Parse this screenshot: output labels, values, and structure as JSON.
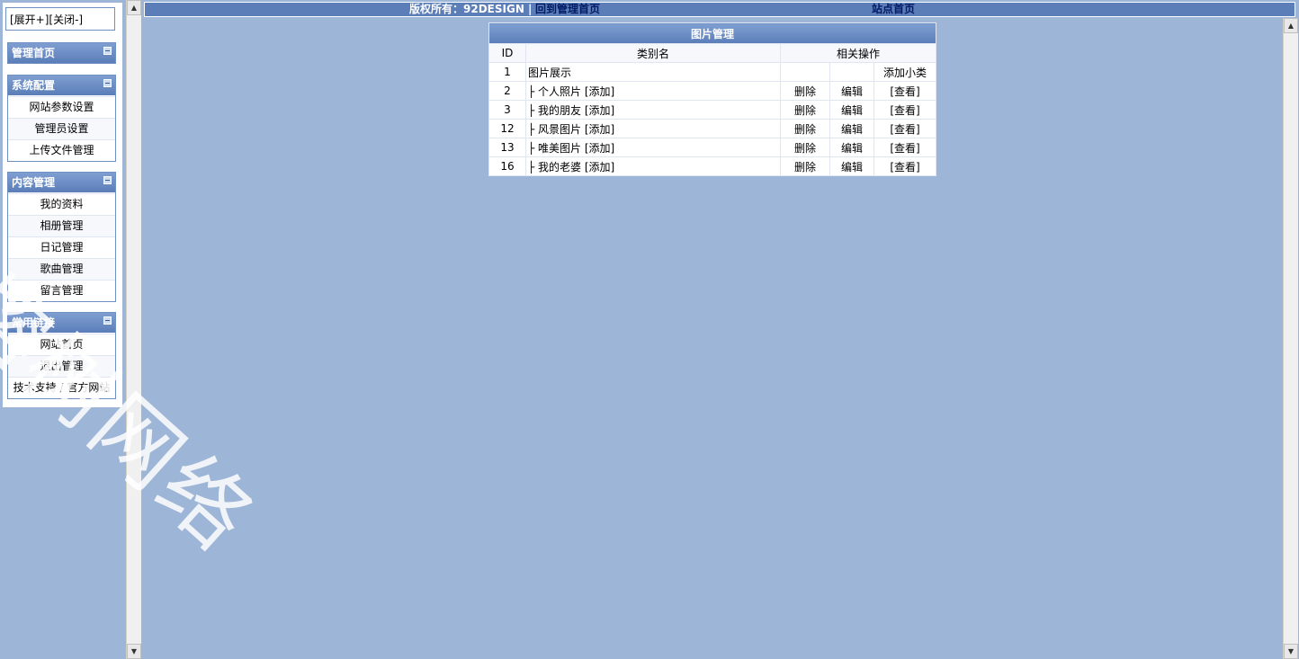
{
  "left": {
    "expand_label": "[展开+]",
    "close_label": "[关闭-]",
    "groups": [
      {
        "title": "管理首页",
        "items": []
      },
      {
        "title": "系统配置",
        "items": [
          "网站参数设置",
          "管理员设置",
          "上传文件管理"
        ]
      },
      {
        "title": "内容管理",
        "items": [
          "我的资料",
          "相册管理",
          "日记管理",
          "歌曲管理",
          "留言管理"
        ]
      },
      {
        "title": "常用链接",
        "items": [
          "网站首页",
          "退出管理",
          "技术支持 / 官方网站"
        ]
      }
    ]
  },
  "top_bar": {
    "copyright": "版权所有：92DESIGN |",
    "home_link": "回到管理首页",
    "site_link": "站点首页"
  },
  "table": {
    "title": "图片管理",
    "headers": {
      "id": "ID",
      "name": "类别名",
      "actions": "相关操作"
    },
    "parent_row": {
      "id": "1",
      "name": "图片展示",
      "add_sub": "添加小类"
    },
    "rows": [
      {
        "id": "2",
        "name": "├ 个人照片 [添加]",
        "del": "删除",
        "edit": "编辑",
        "view": "[查看]"
      },
      {
        "id": "3",
        "name": "├ 我的朋友 [添加]",
        "del": "删除",
        "edit": "编辑",
        "view": "[查看]"
      },
      {
        "id": "12",
        "name": "├ 风景图片 [添加]",
        "del": "删除",
        "edit": "编辑",
        "view": "[查看]"
      },
      {
        "id": "13",
        "name": "├ 唯美图片 [添加]",
        "del": "删除",
        "edit": "编辑",
        "view": "[查看]"
      },
      {
        "id": "16",
        "name": "├ 我的老婆 [添加]",
        "del": "删除",
        "edit": "编辑",
        "view": "[查看]"
      }
    ]
  },
  "watermark": "榕树网络",
  "colors": {
    "background": "#9db5d6",
    "header": "#5b7db8",
    "link": "#001a66"
  }
}
